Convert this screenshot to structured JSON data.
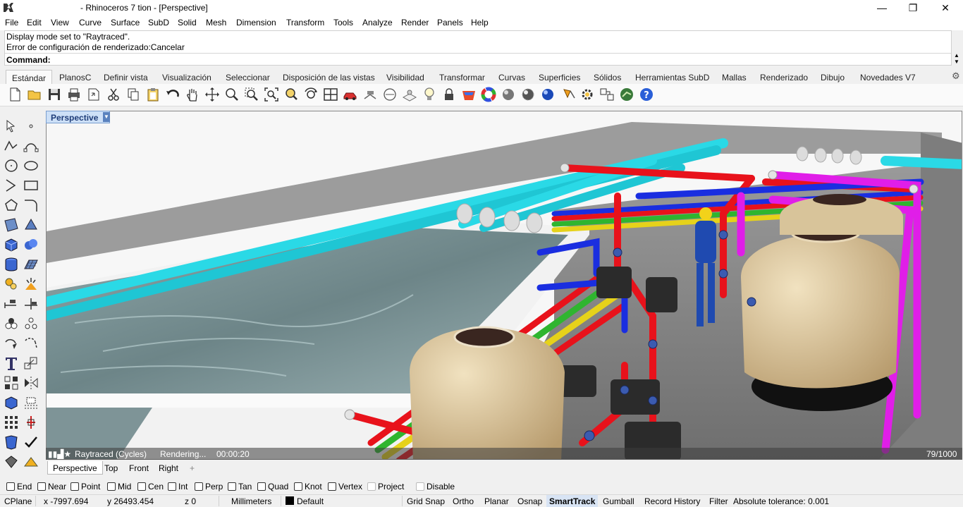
{
  "window": {
    "title": "- Rhinoceros 7 tion - [Perspective]",
    "minimize_glyph": "—",
    "restore_glyph": "❐",
    "close_glyph": "✕"
  },
  "menu": [
    "File",
    "Edit",
    "View",
    "Curve",
    "Surface",
    "SubD",
    "Solid",
    "Mesh",
    "Dimension",
    "Transform",
    "Tools",
    "Analyze",
    "Render",
    "Panels",
    "Help"
  ],
  "command": {
    "history": [
      "Display mode set to \"Raytraced\".",
      "Error de configuración de renderizado:Cancelar"
    ],
    "prompt_label": "Command:",
    "value": ""
  },
  "toolbar_tabs": [
    "Estándar",
    "PlanosC",
    "Definir vista",
    "Visualización",
    "Seleccionar",
    "Disposición de las vistas",
    "Visibilidad",
    "Transformar",
    "Curvas",
    "Superficies",
    "Sólidos",
    "Herramientas SubD",
    "Mallas",
    "Renderizado",
    "Dibujo",
    "Novedades V7"
  ],
  "toolbar_tools": [
    "new-file-icon",
    "open-folder-icon",
    "save-icon",
    "print-icon",
    "import-icon",
    "cut-icon",
    "copy-icon",
    "paste-icon",
    "undo-icon",
    "pan-hand-icon",
    "rotate-view-icon",
    "zoom-icon",
    "zoom-window-icon",
    "zoom-extents-icon",
    "zoom-selected-icon",
    "rotate-camera-icon",
    "four-viewports-icon",
    "named-view-car-icon",
    "place-camera-icon",
    "cplane-icon",
    "light-bulb-icon",
    "lock-icon",
    "material-icon",
    "color-wheel-icon",
    "shaded-sphere-icon",
    "rendered-sphere-icon",
    "render-sphere-blue-icon",
    "properties-icon",
    "options-gear-icon",
    "grasshopper-icon",
    "help-icon"
  ],
  "colors": {
    "accent": "#1e3c78",
    "viewport_tab": "#cde0f7",
    "pipe_cyan": "#2ad9e6",
    "pipe_red": "#e8121b",
    "pipe_blue": "#1a2ee0",
    "pipe_magenta": "#e01ee8",
    "filter_tank": "#e3cfa4"
  },
  "viewport": {
    "title": "Perspective",
    "render_mode": "Raytraced (Cycles)",
    "render_state": "Rendering...",
    "render_time": "00:00:20",
    "passes": "79/1000"
  },
  "viewport_tabs": [
    "Perspective",
    "Top",
    "Front",
    "Right"
  ],
  "viewport_add_glyph": "+",
  "osnaps": [
    {
      "label": "End",
      "checked": false
    },
    {
      "label": "Near",
      "checked": false
    },
    {
      "label": "Point",
      "checked": false
    },
    {
      "label": "Mid",
      "checked": false
    },
    {
      "label": "Cen",
      "checked": false
    },
    {
      "label": "Int",
      "checked": false
    },
    {
      "label": "Perp",
      "checked": false
    },
    {
      "label": "Tan",
      "checked": false
    },
    {
      "label": "Quad",
      "checked": false
    },
    {
      "label": "Knot",
      "checked": false
    },
    {
      "label": "Vertex",
      "checked": false
    },
    {
      "label": "Project",
      "checked": false
    },
    {
      "label": "Disable",
      "checked": false
    }
  ],
  "status": {
    "cplane": "CPlane",
    "x": "x -7997.694",
    "y": "y 26493.454",
    "z": "z 0",
    "units": "Millimeters",
    "layer": "Default",
    "grid_snap": "Grid Snap",
    "ortho": "Ortho",
    "planar": "Planar",
    "osnap": "Osnap",
    "smarttrack": "SmartTrack",
    "gumball": "Gumball",
    "record_history": "Record History",
    "filter": "Filter",
    "tolerance": "Absolute tolerance: 0.001"
  }
}
